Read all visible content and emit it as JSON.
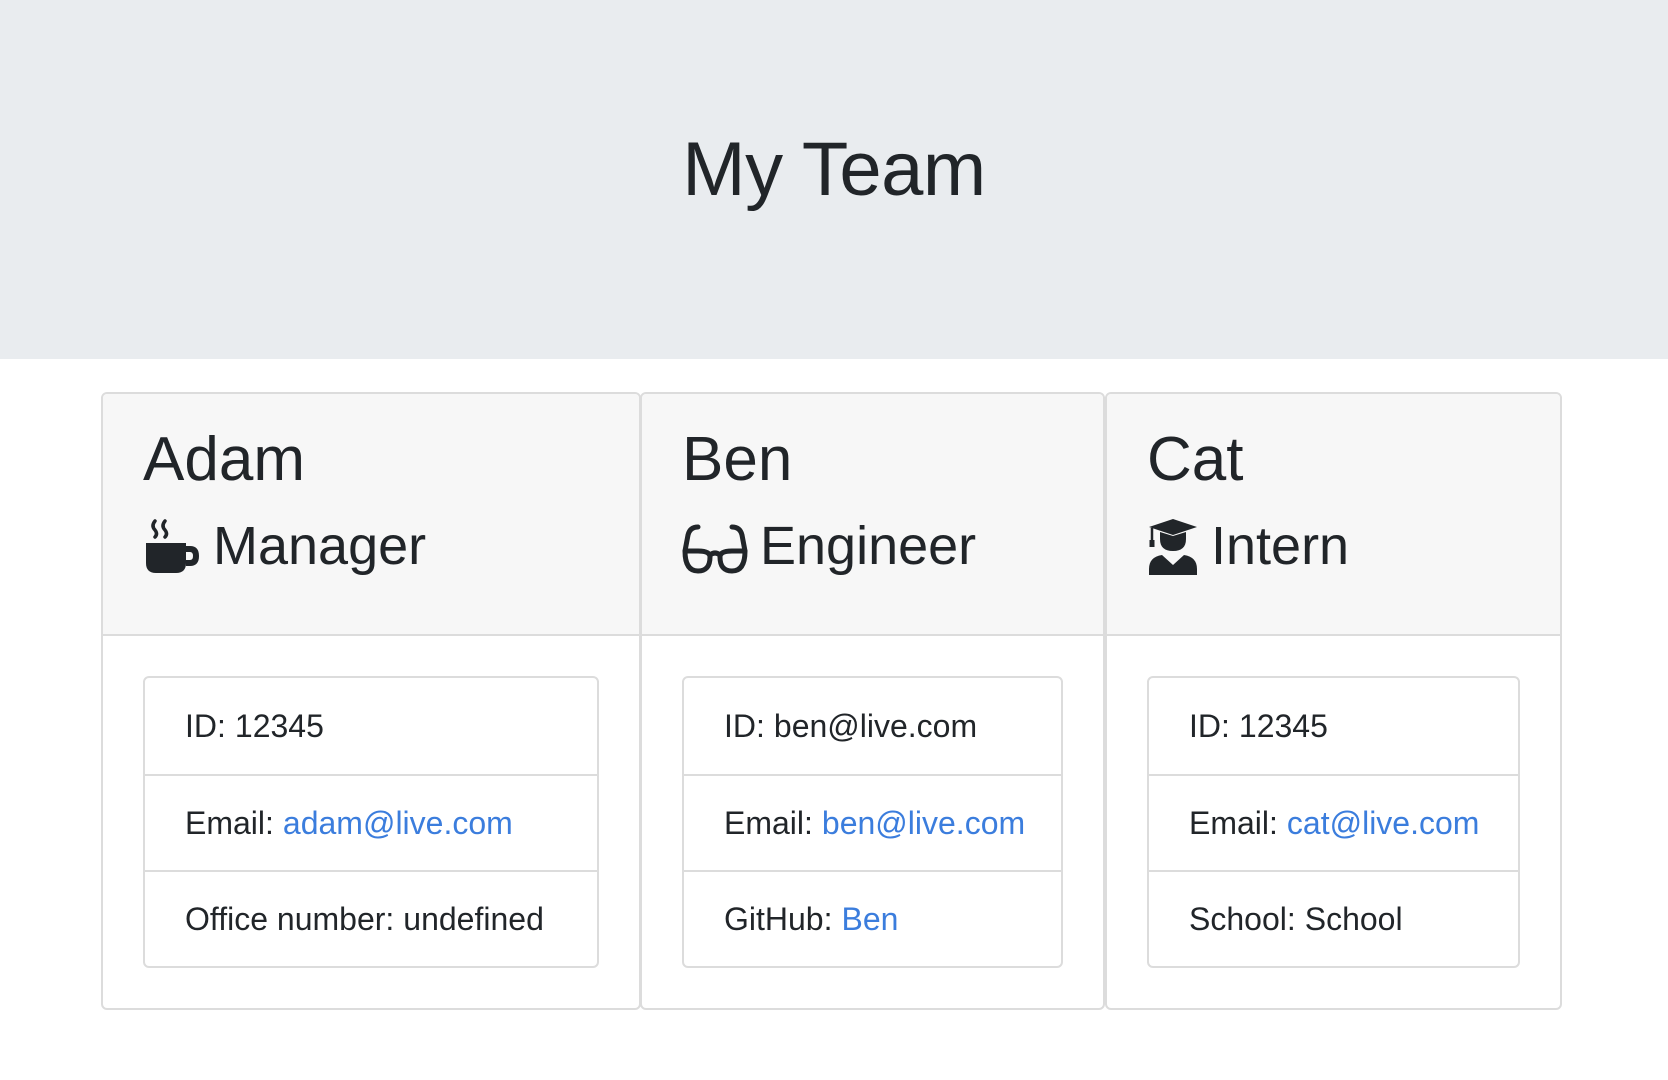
{
  "header": {
    "title": "My Team"
  },
  "members": [
    {
      "name": "Adam",
      "role": "Manager",
      "role_icon": "mug-hot-icon",
      "id_label": "ID:",
      "id_value": "12345",
      "email_label": "Email:",
      "email": "adam@live.com",
      "extra_label": "Office number:",
      "extra_value": "undefined"
    },
    {
      "name": "Ben",
      "role": "Engineer",
      "role_icon": "glasses-icon",
      "id_label": "ID:",
      "id_value": "ben@live.com",
      "email_label": "Email:",
      "email": "ben@live.com",
      "extra_label": "GitHub:",
      "extra_value": "Ben"
    },
    {
      "name": "Cat",
      "role": "Intern",
      "role_icon": "graduate-icon",
      "id_label": "ID:",
      "id_value": "12345",
      "email_label": "Email:",
      "email": "cat@live.com",
      "extra_label": "School:",
      "extra_value": "School"
    }
  ],
  "colors": {
    "link": "#3b7ddd",
    "header_bg": "#e9ecef",
    "card_header_bg": "#f7f7f7",
    "text": "#212529"
  }
}
